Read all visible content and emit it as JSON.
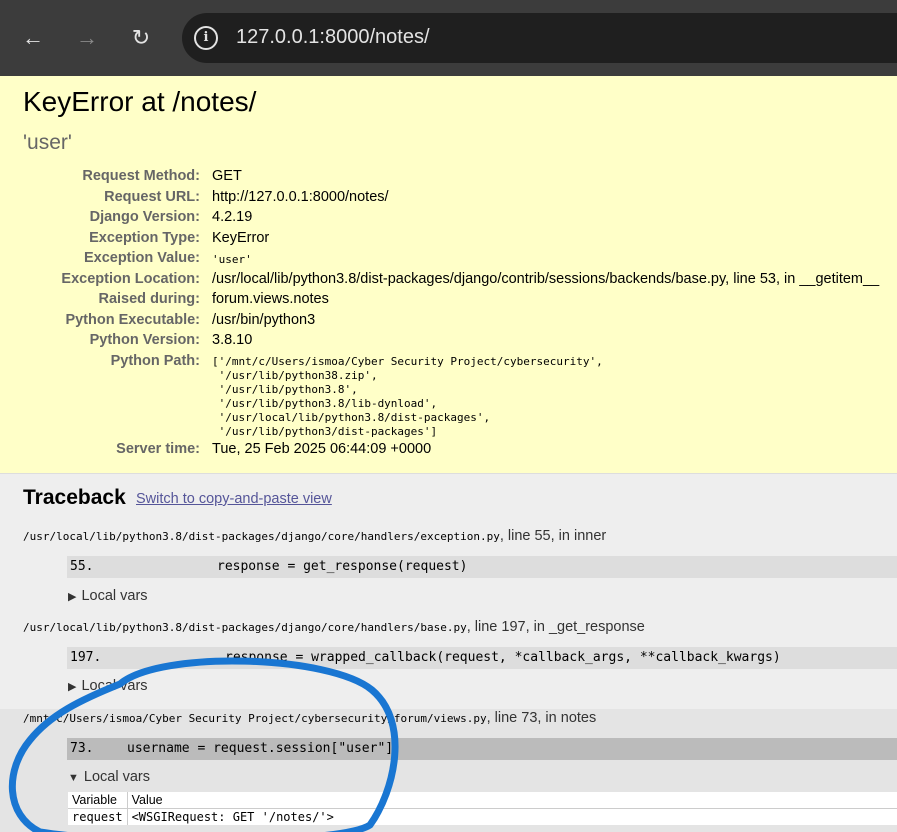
{
  "browser": {
    "back_icon": "arrow-left-icon",
    "forward_icon": "arrow-right-icon",
    "reload_icon": "reload-icon",
    "info_icon": "info-icon",
    "url": "127.0.0.1:8000/notes/"
  },
  "error": {
    "title": "KeyError at /notes/",
    "message": "'user'"
  },
  "meta": {
    "request_method_label": "Request Method:",
    "request_method": "GET",
    "request_url_label": "Request URL:",
    "request_url": "http://127.0.0.1:8000/notes/",
    "django_version_label": "Django Version:",
    "django_version": "4.2.19",
    "exception_type_label": "Exception Type:",
    "exception_type": "KeyError",
    "exception_value_label": "Exception Value:",
    "exception_value": "'user'",
    "exception_location_label": "Exception Location:",
    "exception_location": "/usr/local/lib/python3.8/dist-packages/django/contrib/sessions/backends/base.py, line 53, in __getitem__",
    "raised_during_label": "Raised during:",
    "raised_during": "forum.views.notes",
    "python_executable_label": "Python Executable:",
    "python_executable": "/usr/bin/python3",
    "python_version_label": "Python Version:",
    "python_version": "3.8.10",
    "python_path_label": "Python Path:",
    "python_path": "['/mnt/c/Users/ismoa/Cyber Security Project/cybersecurity',\n '/usr/lib/python38.zip',\n '/usr/lib/python3.8',\n '/usr/lib/python3.8/lib-dynload',\n '/usr/local/lib/python3.8/dist-packages',\n '/usr/lib/python3/dist-packages']",
    "server_time_label": "Server time:",
    "server_time": "Tue, 25 Feb 2025 06:44:09 +0000"
  },
  "traceback": {
    "title": "Traceback",
    "switch_link": "Switch to copy-and-paste view",
    "frames": [
      {
        "file": "/usr/local/lib/python3.8/dist-packages/django/core/handlers/exception.py",
        "location": ", line 55, in inner",
        "line_no": "55.",
        "code": "response = get_response(request)",
        "local_vars": "Local vars"
      },
      {
        "file": "/usr/local/lib/python3.8/dist-packages/django/core/handlers/base.py",
        "location": ", line 197, in _get_response",
        "line_no": "197.",
        "code": "response = wrapped_callback(request, *callback_args, **callback_kwargs)",
        "local_vars": "Local vars"
      },
      {
        "file": "/mnt/c/Users/ismoa/Cyber Security Project/cybersecurity/forum/views.py",
        "location": ", line 73, in notes",
        "line_no": "73.",
        "code": "username = request.session[\"user\"]",
        "local_vars": "Local vars",
        "vars_header": [
          "Variable",
          "Value"
        ],
        "vars": [
          {
            "name": "request",
            "value": "<WSGIRequest: GET '/notes/'>"
          }
        ]
      }
    ]
  },
  "annotation": {
    "color": "#1976d2"
  }
}
